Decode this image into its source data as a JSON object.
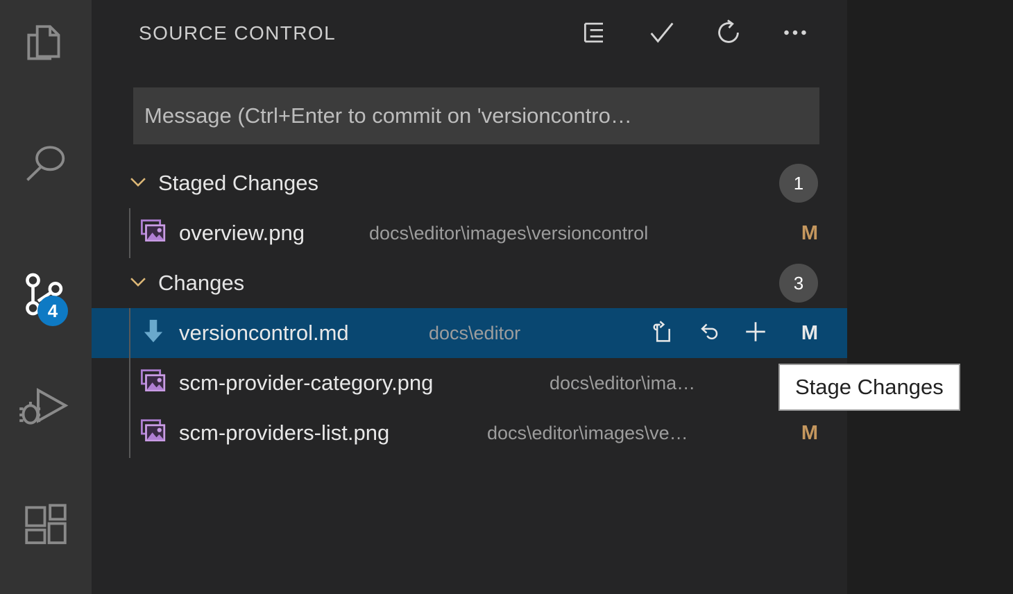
{
  "activity_bar": {
    "items": [
      {
        "name": "explorer",
        "icon": "files-icon",
        "active": false,
        "badge": null
      },
      {
        "name": "search",
        "icon": "search-icon",
        "active": false,
        "badge": null
      },
      {
        "name": "source-control",
        "icon": "source-control-icon",
        "active": true,
        "badge": "4"
      },
      {
        "name": "run-and-debug",
        "icon": "run-and-debug-icon",
        "active": false,
        "badge": null
      },
      {
        "name": "extensions",
        "icon": "extensions-icon",
        "active": false,
        "badge": null
      }
    ]
  },
  "panel": {
    "title": "SOURCE CONTROL",
    "actions": [
      {
        "name": "view-as-list",
        "icon": "list-flat-icon"
      },
      {
        "name": "commit",
        "icon": "check-icon"
      },
      {
        "name": "refresh",
        "icon": "refresh-icon"
      },
      {
        "name": "more-actions",
        "icon": "ellipsis-icon"
      }
    ]
  },
  "commit_input": {
    "placeholder": "Message (Ctrl+Enter to commit on 'versioncontro…",
    "value": ""
  },
  "groups": [
    {
      "label": "Staged Changes",
      "count": "1",
      "expanded": true,
      "files": [
        {
          "name": "overview.png",
          "path": "docs\\editor\\images\\versioncontrol",
          "status": "M",
          "icon": "image-file-icon",
          "selected": false,
          "actions": []
        }
      ]
    },
    {
      "label": "Changes",
      "count": "3",
      "expanded": true,
      "files": [
        {
          "name": "versioncontrol.md",
          "path": "docs\\editor",
          "status": "M",
          "icon": "markdown-file-icon",
          "selected": true,
          "actions": [
            {
              "name": "open-file-button",
              "icon": "open-file-icon"
            },
            {
              "name": "discard-changes-button",
              "icon": "discard-icon"
            },
            {
              "name": "stage-changes-button",
              "icon": "plus-icon"
            }
          ]
        },
        {
          "name": "scm-provider-category.png",
          "path": "docs\\editor\\ima…",
          "status": "",
          "icon": "image-file-icon",
          "selected": false,
          "actions": []
        },
        {
          "name": "scm-providers-list.png",
          "path": "docs\\editor\\images\\ve…",
          "status": "M",
          "icon": "image-file-icon",
          "selected": false,
          "actions": []
        }
      ]
    }
  ],
  "tooltip": {
    "text": "Stage Changes"
  },
  "colors": {
    "activitybar_bg": "#333333",
    "panel_bg": "#252526",
    "editor_bg": "#1e1e1e",
    "selection_blue": "#094771",
    "badge_blue": "#0e7ac4",
    "status_modified": "#c5975e",
    "count_badge_bg": "#4d4d4d"
  }
}
